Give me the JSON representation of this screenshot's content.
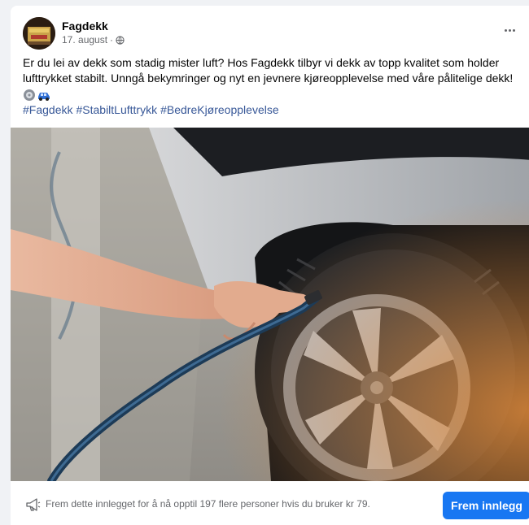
{
  "post": {
    "author": "Fagdekk",
    "date": "17. august",
    "date_separator": "·",
    "body": "Er du lei av dekk som stadig mister luft? Hos Fagdekk tilbyr vi dekk av topp kvalitet som holder lufttrykket stabilt. Unngå bekymringer og nyt en jevnere kjøreopplevelse med våre pålitelige dekk!",
    "emojis": [
      "tire-emoji",
      "car-emoji"
    ],
    "hashtags": [
      "#Fagdekk",
      "#StabiltLufttrykk",
      "#BedreKjøreopplevelse"
    ]
  },
  "footer": {
    "promo_text": "Frem dette innlegget for å nå opptil 197 flere personer hvis du bruker kr 79.",
    "promo_button": "Frem innlegg"
  },
  "colors": {
    "accent": "#1877f2",
    "hashtag": "#385898",
    "secondary_text": "#65676b"
  }
}
